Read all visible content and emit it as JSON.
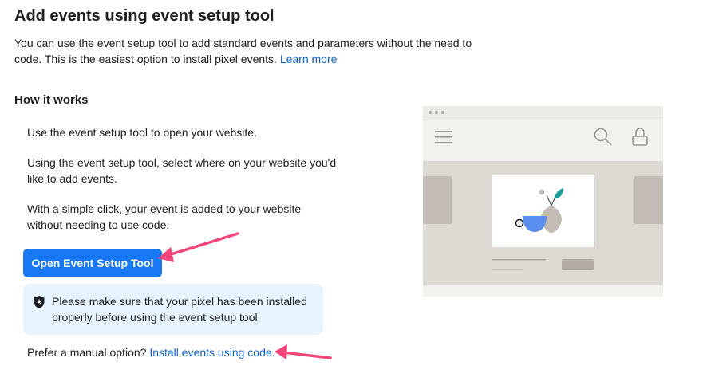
{
  "header": {
    "title": "Add events using event setup tool",
    "intro_text": "You can use the event setup tool to add standard events and parameters without the need to code. This is the easiest option to install pixel events.",
    "learn_more_link": "Learn more"
  },
  "how_it_works": {
    "heading": "How it works",
    "steps": [
      "Use the event setup tool to open your website.",
      "Using the event setup tool, select where on your website you'd like to add events.",
      "With a simple click, your event is added to your website without needing to use code."
    ]
  },
  "primary_button": {
    "label": "Open Event Setup Tool"
  },
  "notice": {
    "icon": "shield-icon",
    "text": "Please make sure that your pixel has been installed properly before using the event setup tool"
  },
  "manual_option": {
    "prefix": "Prefer a manual option?",
    "link": "Install events using code."
  },
  "colors": {
    "accent": "#1877f2",
    "link": "#1264c8",
    "notice_bg": "#e7f3fe",
    "annotation_arrow": "#f0467a"
  }
}
